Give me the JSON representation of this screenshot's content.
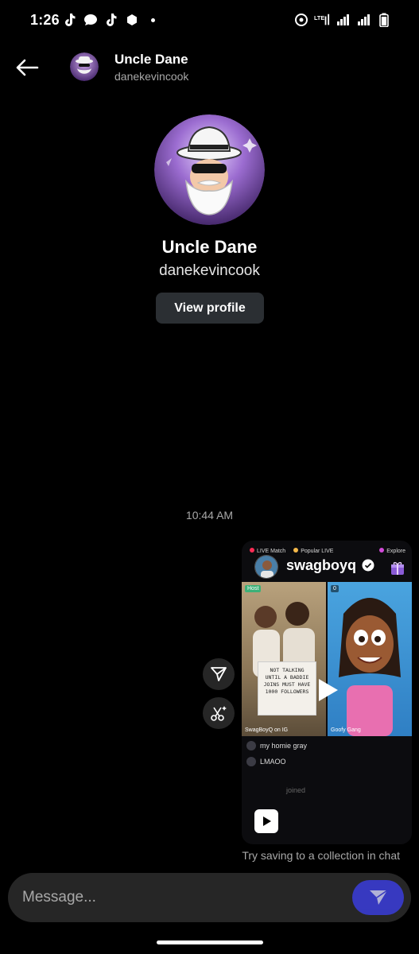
{
  "status_bar": {
    "time": "1:26",
    "left_icons": [
      "tiktok-icon",
      "chat-bubble-icon",
      "tiktok-icon",
      "hexagon-app-icon",
      "notification-dot"
    ],
    "right_icons": [
      "hotspot-icon",
      "lte-icon",
      "signal-icon",
      "signal-icon",
      "battery-icon"
    ],
    "network": "LTE"
  },
  "header": {
    "name": "Uncle Dane",
    "handle": "danekevincook",
    "back_icon": "arrow-left-icon"
  },
  "profile": {
    "name": "Uncle Dane",
    "handle": "danekevincook",
    "view_profile_label": "View profile"
  },
  "conversation": {
    "timestamp": "10:44 AM",
    "shared_video": {
      "username": "swagboyq",
      "verified": true,
      "topbar": [
        "LIVE Match",
        "Popular LIVE",
        "Explore"
      ],
      "left_pane_tag": "Host",
      "left_pane_caption": "SwagBoyQ on IG",
      "right_pane_tag": "0",
      "right_pane_caption": "Goofy Gang",
      "sign_text": "NOT TALKING UNTIL A BADDIE JOINS MUST HAVE 1000 FOLLOWERS",
      "chat_lines": [
        "my homie gray",
        "LMAOO",
        "joined"
      ]
    },
    "hint": "Try saving to a collection in chat"
  },
  "composer": {
    "placeholder": "Message..."
  },
  "colors": {
    "background": "#000000",
    "button_bg": "#2b2f33",
    "composer_bg": "#262626",
    "send_accent": "#3a3ddb",
    "secondary_text": "#a8a8a8"
  }
}
